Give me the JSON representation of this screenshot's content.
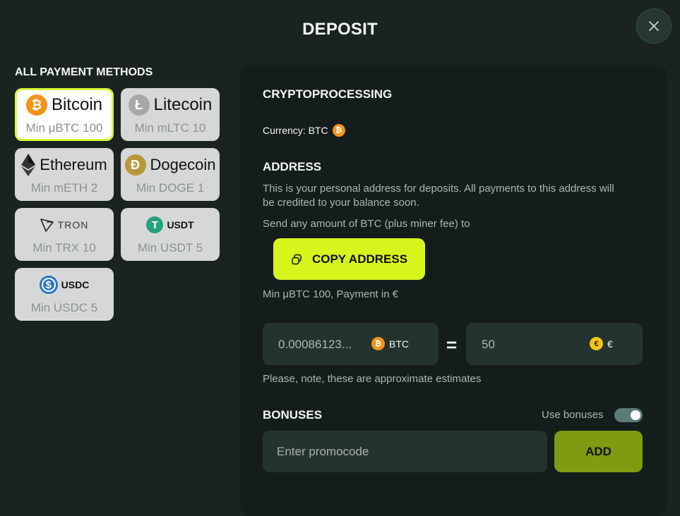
{
  "header": {
    "title": "DEPOSIT"
  },
  "methods": {
    "heading": "ALL PAYMENT METHODS",
    "items": [
      {
        "name": "Bitcoin",
        "min": "Min μBTC 100",
        "icon": "bitcoin-icon",
        "selected": true
      },
      {
        "name": "Litecoin",
        "min": "Min mLTC 10",
        "icon": "litecoin-icon"
      },
      {
        "name": "Ethereum",
        "min": "Min mETH 2",
        "icon": "ethereum-icon"
      },
      {
        "name": "Dogecoin",
        "min": "Min DOGE 1",
        "icon": "dogecoin-icon"
      },
      {
        "name": "TRON",
        "min": "Min TRX 10",
        "icon": "tron-icon"
      },
      {
        "name": "USDT",
        "min": "Min USDT 5",
        "icon": "tether-icon"
      },
      {
        "name": "USDC",
        "min": "Min USDC 5",
        "icon": "usdc-icon"
      }
    ]
  },
  "panel": {
    "provider": "CRYPTOPROCESSING",
    "currency_label": "Currency: BTC",
    "address_heading": "ADDRESS",
    "address_desc_1": "This is your personal address for deposits. All payments to this address will",
    "address_desc_2": "be credited to your balance soon.",
    "send_text": "Send any amount of BTC (plus miner fee) to",
    "copy_label": "COPY ADDRESS",
    "min_payment": "Min μBTC 100, Payment in €",
    "crypto_amount": "0.00086123...",
    "crypto_code": "BTC",
    "equals": "=",
    "fiat_amount": "50",
    "fiat_code": "€",
    "estimate_note": "Please, note, these are approximate estimates",
    "bonuses_heading": "BONUSES",
    "use_bonuses_label": "Use bonuses",
    "use_bonuses_on": true,
    "promo_placeholder": "Enter promocode",
    "add_label": "ADD"
  },
  "colors": {
    "background": "#1b2321",
    "panel": "#151d1c",
    "accent": "#d6f51c",
    "add_button": "#7f9b12",
    "bitcoin": "#f7931a",
    "euro": "#f5c518"
  }
}
